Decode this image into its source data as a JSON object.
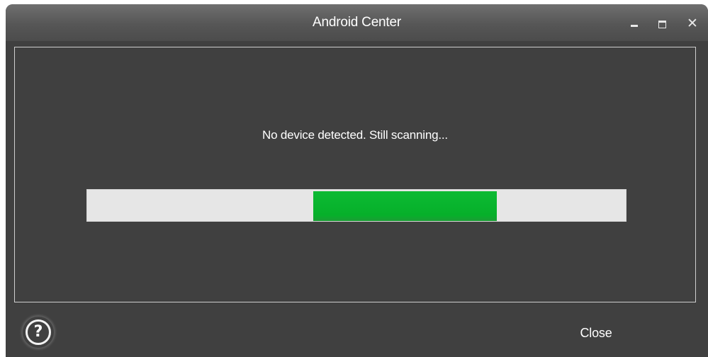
{
  "window": {
    "title": "Android Center",
    "controls": {
      "minimize_icon": "minimize-icon",
      "maximize_icon": "maximize-icon",
      "close_icon": "close-icon",
      "close_glyph": "✕"
    }
  },
  "main": {
    "status": "No device detected. Still scanning...",
    "progress": {
      "indeterminate": true,
      "segment_start_fraction": 0.42,
      "segment_end_fraction": 0.76
    }
  },
  "footer": {
    "help_glyph": "?",
    "help_icon": "help-circle-icon",
    "close_label": "Close"
  },
  "colors": {
    "frame": "#404040",
    "titlebar": "#5a5a5a",
    "progress_track": "#e6e6e6",
    "progress_fill": "#06b02a",
    "panel_border": "#cfcfcf"
  }
}
